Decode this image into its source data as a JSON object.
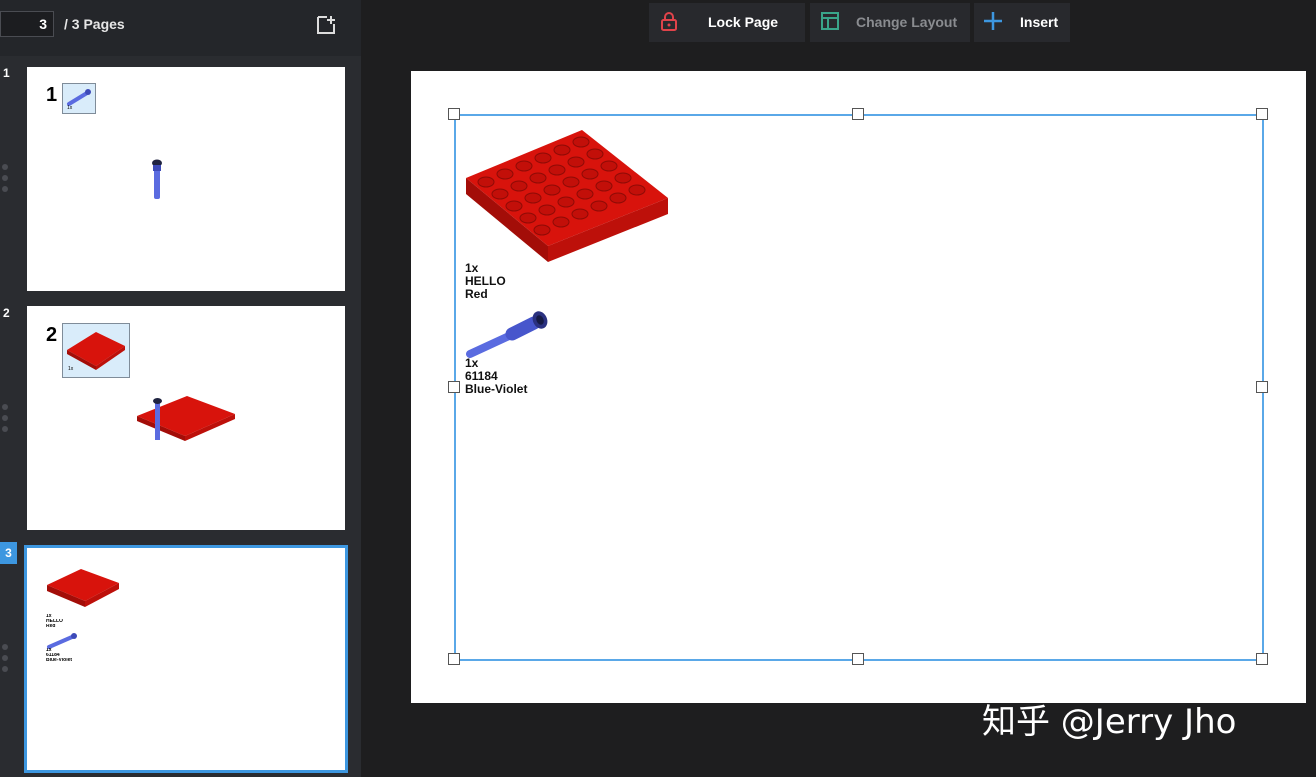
{
  "pager": {
    "current": "3",
    "total_label": "/ 3 Pages"
  },
  "toolbar": {
    "lock_label": "Lock Page",
    "layout_label": "Change Layout",
    "insert_label": "Insert",
    "lock_color": "#e0434a",
    "layout_color": "#3aa58a",
    "insert_color": "#3d97e0"
  },
  "thumbnails": [
    {
      "number": "1",
      "step": "1",
      "pli_qty": "1x"
    },
    {
      "number": "2",
      "step": "2",
      "pli_qty": "1x"
    },
    {
      "number": "3",
      "labels": [
        "1x",
        "HELLO",
        "Red",
        "1x",
        "61184",
        "Blue-Violet"
      ]
    }
  ],
  "canvas": {
    "parts": [
      {
        "qty": "1x",
        "id": "HELLO",
        "color": "Red",
        "color_hex": "#d8130c"
      },
      {
        "qty": "1x",
        "id": "61184",
        "color": "Blue-Violet",
        "color_hex": "#5a6be0"
      }
    ]
  },
  "watermark": "知乎 @Jerry Jho"
}
